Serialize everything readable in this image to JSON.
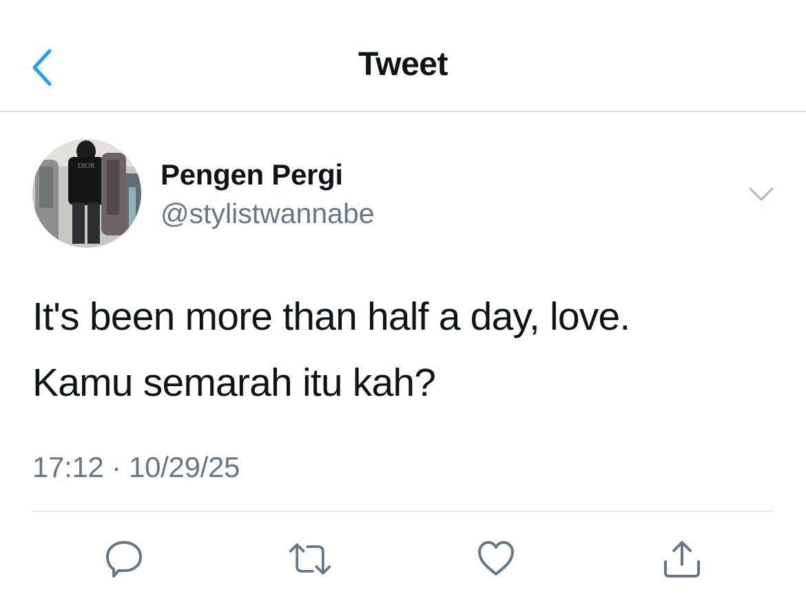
{
  "header": {
    "title": "Tweet",
    "back_icon": "chevron-left-icon",
    "accent_color": "#1da1f2"
  },
  "tweet": {
    "author": {
      "display_name": "Pengen Pergi",
      "handle": "@stylistwannabe",
      "avatar_logo_text": "DIOR"
    },
    "text_lines": [
      "It's been more than half a day, love.",
      "Kamu semarah itu kah?"
    ],
    "timestamp": "17:12 · 10/29/25",
    "more_icon": "chevron-down-icon"
  },
  "actions": [
    {
      "name": "reply",
      "icon": "speech-bubble-icon"
    },
    {
      "name": "retweet",
      "icon": "retweet-icon"
    },
    {
      "name": "like",
      "icon": "heart-icon"
    },
    {
      "name": "share",
      "icon": "share-icon"
    }
  ],
  "colors": {
    "text_primary": "#0f1419",
    "text_secondary": "#657786",
    "icon_gray": "#657786",
    "divider": "#e6e9eb"
  }
}
